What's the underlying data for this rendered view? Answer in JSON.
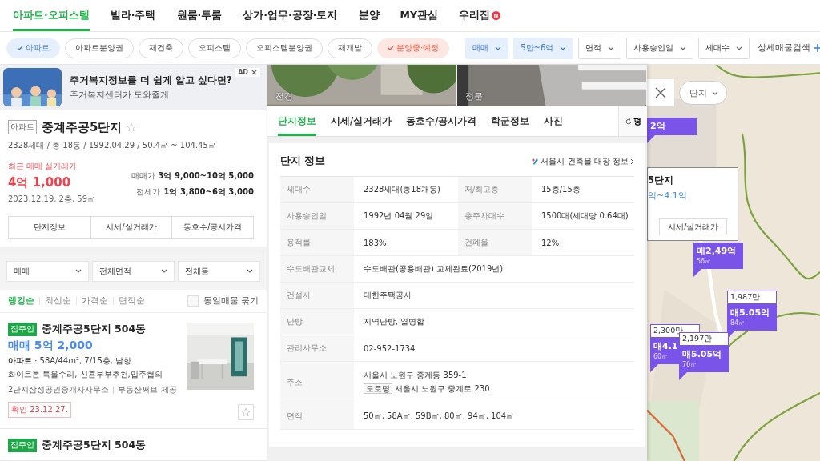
{
  "nav": {
    "tabs": [
      {
        "label": "아파트·오피스텔",
        "selected": true
      },
      {
        "label": "빌라·주택",
        "selected": false
      },
      {
        "label": "원룸·투룸",
        "selected": false
      },
      {
        "label": "상가·업무·공장·토지",
        "selected": false
      },
      {
        "label": "분양",
        "selected": false
      },
      {
        "label": "MY관심",
        "selected": false
      },
      {
        "label": "우리집",
        "selected": false,
        "badge": "N"
      }
    ]
  },
  "filters": {
    "chips": [
      {
        "label": "아파트",
        "selected": true,
        "kind": "type"
      },
      {
        "label": "아파트분양권",
        "selected": false,
        "kind": "type"
      },
      {
        "label": "재건축",
        "selected": false,
        "kind": "type"
      },
      {
        "label": "오피스텔",
        "selected": false,
        "kind": "type"
      },
      {
        "label": "오피스텔분양권",
        "selected": false,
        "kind": "type"
      },
      {
        "label": "재개발",
        "selected": false,
        "kind": "type"
      },
      {
        "label": "분양중·예정",
        "selected": true,
        "kind": "sale"
      }
    ],
    "dropdowns": [
      {
        "label": "매매",
        "selected": true
      },
      {
        "label": "5만~6억",
        "selected": true
      },
      {
        "label": "면적",
        "selected": false
      },
      {
        "label": "사용승인일",
        "selected": false
      },
      {
        "label": "세대수",
        "selected": false
      }
    ],
    "detail_search": "상세매물검색"
  },
  "ad": {
    "tag": "AD",
    "title": "주거복지정보를 더 쉽게 알고 싶다면?",
    "subtitle": "주거복지센터가 도와줄게"
  },
  "complex": {
    "type_badge": "아파트",
    "name": "중계주공5단지",
    "favorite": false,
    "summary": "2328세대 / 총 18동 / 1992.04.29 / 50.4㎡ ~ 104.45㎡",
    "recent_label": "최근 매매 실거래가",
    "recent_price": "4억 1,000",
    "recent_date": "2023.12.19, 2층, 59㎡",
    "ranges": [
      {
        "label": "매매가",
        "value": "3억 9,000~10억 5,000"
      },
      {
        "label": "전세가",
        "value": "1억 3,800~6억 3,000"
      }
    ],
    "buttons": [
      "단지정보",
      "시세/실거래가",
      "동호수/공시가격"
    ]
  },
  "list_filters": [
    "매매",
    "전체면적",
    "전체동"
  ],
  "sort": {
    "options": [
      {
        "label": "랭킹순",
        "selected": true
      },
      {
        "label": "최신순",
        "selected": false
      },
      {
        "label": "가격순",
        "selected": false
      },
      {
        "label": "면적순",
        "selected": false
      }
    ],
    "group_same": {
      "label": "동일매물 묶기",
      "checked": false
    }
  },
  "listings": [
    {
      "owner_badge": "집주인",
      "title": "중계주공5단지 504동",
      "price": "매매 5억 2,000",
      "spec": "**아파트** · 58A/44m², 7/15층, 남향",
      "description": "화이트톤 특올수리, 신혼부부추천,입주협의",
      "agent": "2단지삼성공인중개사사무소",
      "provider": "부동산써브 제공",
      "confirmed": "확인 23.12.27.",
      "favorite": false
    },
    {
      "owner_badge": "집주인",
      "title": "중계주공5단지 504동"
    }
  ],
  "detail": {
    "photos": [
      {
        "caption": "전경"
      },
      {
        "caption": "정문"
      }
    ],
    "tabs": [
      {
        "label": "단지정보",
        "selected": true
      },
      {
        "label": "시세/실거래가",
        "selected": false
      },
      {
        "label": "동호수/공시가격",
        "selected": false
      },
      {
        "label": "학군정보",
        "selected": false
      },
      {
        "label": "사진",
        "selected": false
      }
    ],
    "unit_toggle": "평",
    "section_title": "단지 정보",
    "external_link": "서울시 건축물 대장 정보",
    "rows": [
      {
        "kind": "pair",
        "label": "세대수",
        "value": "2328세대(총18개동)",
        "label2": "저/최고층",
        "value2": "15층/15층"
      },
      {
        "kind": "pair",
        "label": "사용승인일",
        "value": "1992년 04월 29일",
        "label2": "총주차대수",
        "value2": "1500대(세대당 0.64대)"
      },
      {
        "kind": "pair",
        "label": "용적률",
        "value": "183%",
        "label2": "건폐율",
        "value2": "12%"
      },
      {
        "kind": "single",
        "label": "수도배관교체",
        "value": "수도배관(공용배관) 교체완료(2019년)"
      },
      {
        "kind": "single",
        "label": "건설사",
        "value": "대한주택공사"
      },
      {
        "kind": "single",
        "label": "난방",
        "value": "지역난방, 열병합"
      },
      {
        "kind": "single",
        "label": "관리사무소",
        "value": "02-952-1734"
      },
      {
        "kind": "address",
        "label": "주소",
        "value": "서울시 노원구 중계동 359-1",
        "road_tag": "도로명",
        "road_value": "서울시 노원구 중계로 230"
      },
      {
        "kind": "single",
        "label": "면적",
        "value": "50㎡, 58A㎡, 59B㎡, 80㎡, 94㎡, 104㎡"
      }
    ]
  },
  "map": {
    "filter_chip": "단지",
    "popup": {
      "name": "5단지",
      "price": "억~4.1억",
      "button": "시세/실거래가"
    },
    "markers": [
      {
        "price": "2억"
      },
      {
        "price": "매2,49억",
        "area": "56㎡"
      },
      {
        "count": "1,987만",
        "price": "매5.05억",
        "area": "84㎡"
      },
      {
        "count": "2,300만",
        "price": "매4.1",
        "area": "60㎡"
      },
      {
        "count": "2,197만",
        "price": "매5.05억",
        "area": "76㎡"
      }
    ]
  }
}
